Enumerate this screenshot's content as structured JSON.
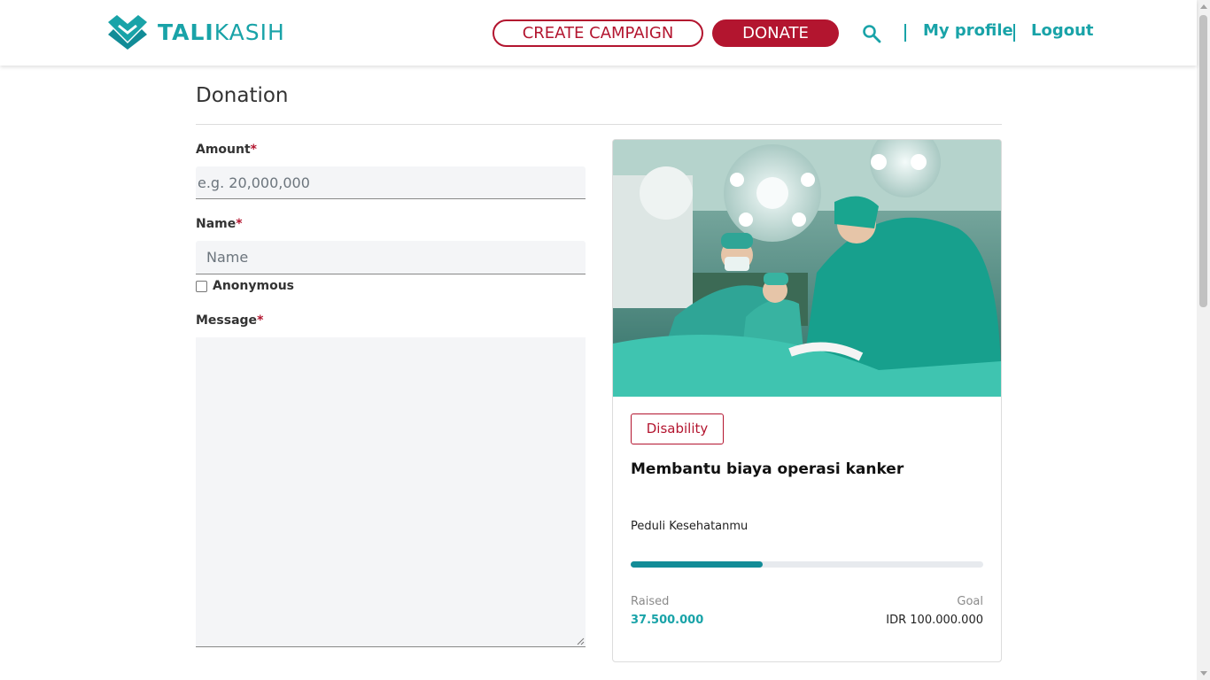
{
  "header": {
    "brand_bold": "TALI",
    "brand_light": "KASIH",
    "create_label": "CREATE CAMPAIGN",
    "donate_label": "DONATE",
    "profile_label": "My profile",
    "logout_label": "Logout"
  },
  "page": {
    "title": "Donation"
  },
  "form": {
    "amount": {
      "label": "Amount",
      "required_mark": "*",
      "placeholder": "e.g. 20,000,000",
      "value": ""
    },
    "name": {
      "label": "Name",
      "required_mark": "*",
      "placeholder": "Name",
      "value": ""
    },
    "anonymous": {
      "label": "Anonymous",
      "checked": false
    },
    "message": {
      "label": "Message",
      "required_mark": "*",
      "value": ""
    }
  },
  "campaign": {
    "category": "Disability",
    "title": "Membantu biaya operasi kanker",
    "organizer": "Peduli Kesehatanmu",
    "raised_label": "Raised",
    "raised_value": "37.500.000",
    "goal_label": "Goal",
    "goal_value": "IDR 100.000.000",
    "progress_fraction": 0.375
  },
  "colors": {
    "brand_teal": "#19a3a8",
    "brand_red": "#b3152f",
    "progress_fill": "#128c97"
  },
  "icons": {
    "logo": "talikasih-logo-icon",
    "search": "search-icon"
  }
}
